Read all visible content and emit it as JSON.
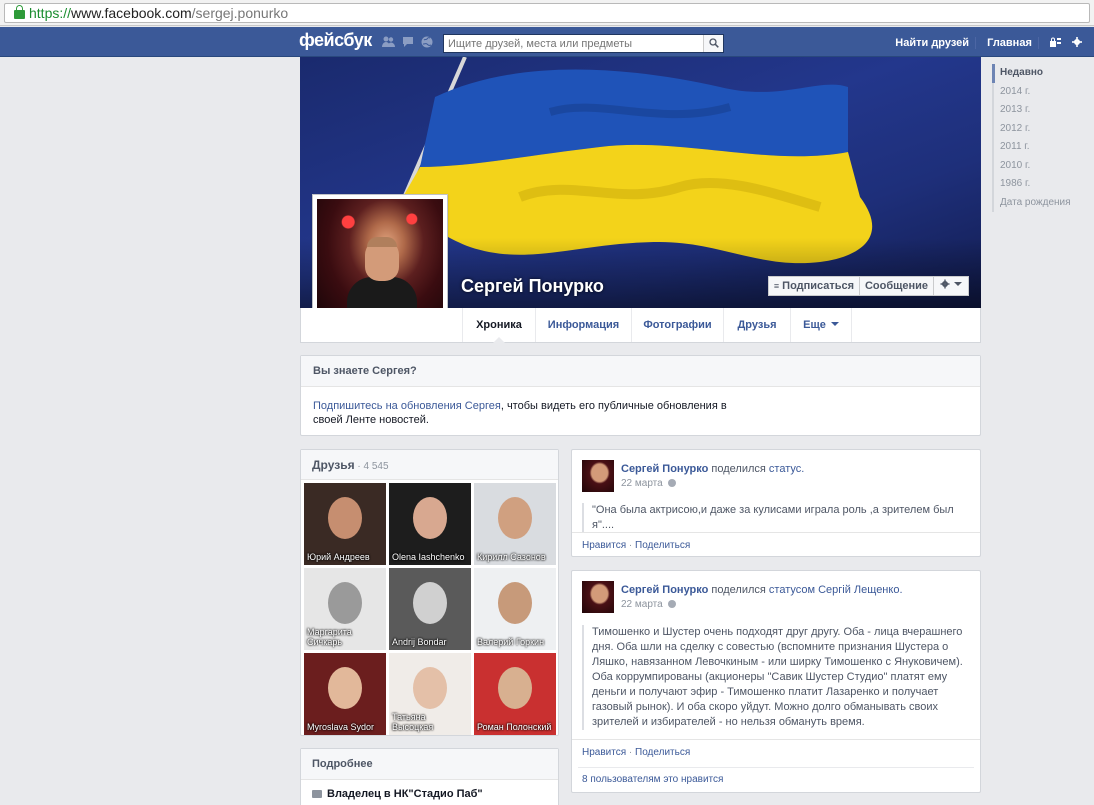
{
  "browser": {
    "url_scheme": "https://",
    "url_host": "www.facebook.com",
    "url_path": "/sergej.ponurko"
  },
  "topbar": {
    "logo": "фейсбук",
    "search_placeholder": "Ищите друзей, места или предметы",
    "nav_find_friends": "Найти друзей",
    "nav_home": "Главная",
    "brand_color": "#3b5998"
  },
  "profile": {
    "name": "Сергей Понурко",
    "subscribe_label": "Подписаться",
    "message_label": "Сообщение"
  },
  "tabs": [
    {
      "label": "Хроника"
    },
    {
      "label": "Информация"
    },
    {
      "label": "Фотографии"
    },
    {
      "label": "Друзья"
    },
    {
      "label": "Еще"
    }
  ],
  "years": [
    "Недавно",
    "2014 г.",
    "2013 г.",
    "2012 г.",
    "2011 г.",
    "2010 г.",
    "1986 г.",
    "Дата рождения"
  ],
  "know": {
    "title": "Вы знаете Сергея?",
    "link_text": "Подпишитесь на обновления Сергея",
    "rest_text": ", чтобы видеть его публичные обновления в своей Ленте новостей."
  },
  "friends": {
    "title": "Друзья",
    "count": " · 4 545",
    "items": [
      {
        "name": "Юрий Андреев",
        "bg": "#3a2a24",
        "face": "#c68e70"
      },
      {
        "name": "Olena Iashchenko",
        "bg": "#1d1d1d",
        "face": "#d8a890"
      },
      {
        "name": "Кирилл Сазонов",
        "bg": "#d9dce0",
        "face": "#d0a080"
      },
      {
        "name": "Маргарита Сичкарь",
        "bg": "#e6e6e6",
        "face": "#9a9a9a"
      },
      {
        "name": "Andrij Bondar",
        "bg": "#5a5a5a",
        "face": "#d0d0d0"
      },
      {
        "name": "Валерий Горкин",
        "bg": "#eef0f2",
        "face": "#c79a7a"
      },
      {
        "name": "Myroslava Sydor",
        "bg": "#6b1e1e",
        "face": "#e2b89a"
      },
      {
        "name": "Татьяна Высоцкая",
        "bg": "#f0ece8",
        "face": "#e4c0a8"
      },
      {
        "name": "Роман Полонский",
        "bg": "#c93030",
        "face": "#d8b090"
      }
    ]
  },
  "more": {
    "title": "Подробнее",
    "item": "Владелец в НК\"Стадио Паб\""
  },
  "posts": [
    {
      "author": "Сергей Понурко",
      "verb": " поделился ",
      "object": "статус.",
      "date": "22 марта",
      "text": "\"Она была актрисою,и даже за кулисами играла роль ,а зрителем был я\"....",
      "like": "Нравится",
      "share": "Поделиться"
    },
    {
      "author": "Сергей Понурко",
      "verb": " поделился ",
      "object": "статусом Сергій Лещенко.",
      "date": "22 марта",
      "text": "Тимошенко и Шустер очень подходят друг другу. Оба - лица вчерашнего дня. Оба шли на сделку с совестью (вспомните признания Шустера о Ляшко, навязанном Левочкиным - или ширку Тимошенко с Януковичем). Оба коррумпированы (акционеры \"Савик Шустер Студио\" платят ему деньги и получают эфир - Тимошенко платит Лазаренко и получает газовый рынок). И оба скоро уйдут. Можно долго обманывать своих зрителей и избирателей - но нельзя обмануть время.",
      "like": "Нравится",
      "share": "Поделиться",
      "likes_count": "8 пользователям это нравится"
    }
  ]
}
